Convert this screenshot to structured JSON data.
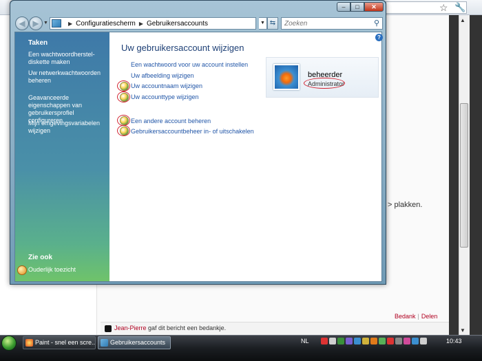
{
  "background": {
    "paste_text": "> plakken.",
    "links": {
      "bedank": "Bedank",
      "separator": "|",
      "delen": "Delen"
    },
    "thanks": {
      "name": "Jean-Pierre",
      "text": " gaf dit bericht een bedankje."
    }
  },
  "window": {
    "caption": {
      "minimize": "–",
      "maximize": "□",
      "close": "✕"
    },
    "breadcrumb": [
      "Configuratiescherm",
      "Gebruikersaccounts"
    ],
    "search": {
      "placeholder": "Zoeken"
    },
    "left_pane": {
      "title": "Taken",
      "links": [
        "Een wachtwoordherstel­diskette maken",
        "Uw netwerkwachtwoorden beheren",
        "Geavanceerde eigenschappen van gebruikersprofiel configureren",
        "Mijn omgevingsvariabelen wijzigen"
      ],
      "see_also_title": "Zie ook",
      "see_also_link": "Ouderlijk toezicht"
    },
    "main": {
      "title": "Uw gebruikersaccount wijzigen",
      "tasks": [
        "Een wachtwoord voor uw account instellen",
        "Uw afbeelding wijzigen",
        "Uw accountnaam wijzigen",
        "Uw accounttype wijzigen"
      ],
      "tasks2": [
        "Een andere account beheren",
        "Gebruikersaccountbeheer in- of uitschakelen"
      ]
    },
    "user": {
      "name": "beheerder",
      "role": "Administrator"
    }
  },
  "taskbar": {
    "buttons": [
      "Paint - snel een scre...",
      "Gebruikersaccounts"
    ],
    "language": "NL",
    "clock": "10:43"
  }
}
